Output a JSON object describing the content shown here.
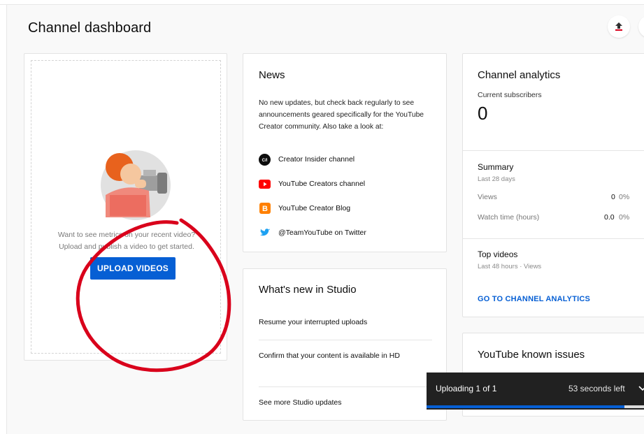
{
  "header": {
    "title": "Channel dashboard",
    "upload_icon": "upload-icon"
  },
  "upload_card": {
    "prompt_line1": "Want to see metrics on your recent video?",
    "prompt_line2": "Upload and publish a video to get started.",
    "button_label": "UPLOAD VIDEOS",
    "accent_color": "#065fd4",
    "annotation_color": "#d9001b"
  },
  "news": {
    "title": "News",
    "body": "No new updates, but check back regularly to see announcements geared specifically for the YouTube Creator community. Also take a look at:",
    "links": [
      {
        "label": "Creator Insider channel",
        "icon": "creator-insider-icon"
      },
      {
        "label": "YouTube Creators channel",
        "icon": "youtube-play-icon"
      },
      {
        "label": "YouTube Creator Blog",
        "icon": "blogger-icon"
      },
      {
        "label": "@TeamYouTube on Twitter",
        "icon": "twitter-bird-icon"
      }
    ]
  },
  "studio": {
    "title": "What's new in Studio",
    "items": [
      "Resume your interrupted uploads",
      "Confirm that your content is available in HD",
      "See more Studio updates"
    ]
  },
  "analytics": {
    "title": "Channel analytics",
    "subscribers_label": "Current subscribers",
    "subscribers_value": "0",
    "summary_title": "Summary",
    "summary_period": "Last 28 days",
    "metrics": [
      {
        "label": "Views",
        "value": "0",
        "change": "0%"
      },
      {
        "label": "Watch time (hours)",
        "value": "0.0",
        "change": "0%"
      }
    ],
    "top_videos_title": "Top videos",
    "top_videos_period": "Last 48 hours · Views",
    "link_label": "GO TO CHANNEL ANALYTICS"
  },
  "issues": {
    "title": "YouTube known issues"
  },
  "upload_toast": {
    "status": "Uploading 1 of 1",
    "time_left": "53 seconds left",
    "progress_percent": 91
  }
}
